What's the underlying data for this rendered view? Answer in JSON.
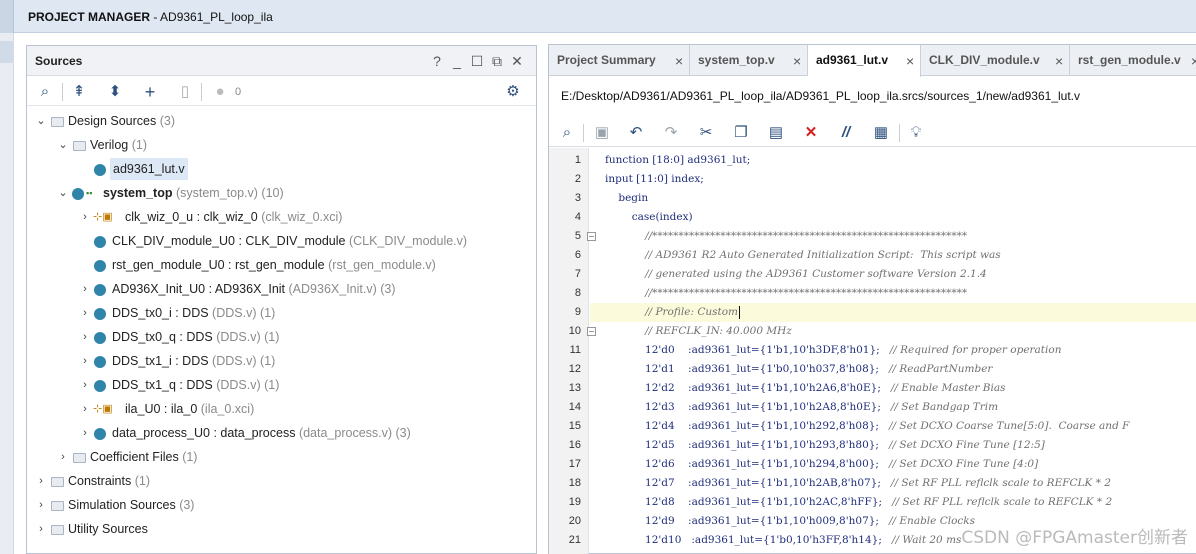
{
  "project_manager": {
    "label": "PROJECT MANAGER",
    "separator": " - ",
    "project": "AD9361_PL_loop_ila"
  },
  "sources": {
    "title": "Sources",
    "help": "?",
    "status_count": "0",
    "tree": [
      {
        "label": "Design Sources",
        "meta": "(3)"
      },
      {
        "label": "Verilog",
        "meta": "(1)"
      },
      {
        "label": "ad9361_lut.v",
        "meta": ""
      },
      {
        "label": "system_top",
        "meta": "(system_top.v) (10)"
      },
      {
        "label": "clk_wiz_0_u : clk_wiz_0",
        "meta": "(clk_wiz_0.xci)"
      },
      {
        "label": "CLK_DIV_module_U0 : CLK_DIV_module",
        "meta": "(CLK_DIV_module.v)"
      },
      {
        "label": "rst_gen_module_U0 : rst_gen_module",
        "meta": "(rst_gen_module.v)"
      },
      {
        "label": "AD936X_Init_U0 : AD936X_Init",
        "meta": "(AD936X_Init.v) (3)"
      },
      {
        "label": "DDS_tx0_i : DDS",
        "meta": "(DDS.v) (1)"
      },
      {
        "label": "DDS_tx0_q : DDS",
        "meta": "(DDS.v) (1)"
      },
      {
        "label": "DDS_tx1_i : DDS",
        "meta": "(DDS.v) (1)"
      },
      {
        "label": "DDS_tx1_q : DDS",
        "meta": "(DDS.v) (1)"
      },
      {
        "label": "ila_U0 : ila_0",
        "meta": "(ila_0.xci)"
      },
      {
        "label": "data_process_U0 : data_process",
        "meta": "(data_process.v) (3)"
      },
      {
        "label": "Coefficient Files",
        "meta": "(1)"
      },
      {
        "label": "Constraints",
        "meta": "(1)"
      },
      {
        "label": "Simulation Sources",
        "meta": "(3)"
      },
      {
        "label": "Utility Sources",
        "meta": ""
      }
    ]
  },
  "editor": {
    "tabs": [
      {
        "label": "Project Summary"
      },
      {
        "label": "system_top.v"
      },
      {
        "label": "ad9361_lut.v"
      },
      {
        "label": "CLK_DIV_module.v"
      },
      {
        "label": "rst_gen_module.v"
      }
    ],
    "path": "E:/Desktop/AD9361/AD9361_PL_loop_ila/AD9361_PL_loop_ila.srcs/sources_1/new/ad9361_lut.v",
    "lines": [
      {
        "n": "1",
        "code": "function [18:0] ad9361_lut;",
        "cmt": ""
      },
      {
        "n": "2",
        "code": "input [11:0] index;",
        "cmt": ""
      },
      {
        "n": "3",
        "code": "    begin",
        "cmt": ""
      },
      {
        "n": "4",
        "code": "        case(index)",
        "cmt": ""
      },
      {
        "n": "5",
        "code": "            ",
        "cmt": "//************************************************************"
      },
      {
        "n": "6",
        "code": "            ",
        "cmt": "// AD9361 R2 Auto Generated Initialization Script:  This script was"
      },
      {
        "n": "7",
        "code": "            ",
        "cmt": "// generated using the AD9361 Customer software Version 2.1.4"
      },
      {
        "n": "8",
        "code": "            ",
        "cmt": "//************************************************************"
      },
      {
        "n": "9",
        "code": "            ",
        "cmt": "// Profile: Custom"
      },
      {
        "n": "10",
        "code": "            ",
        "cmt": "// REFCLK_IN: 40.000 MHz"
      },
      {
        "n": "11",
        "code": "            12'd0    :ad9361_lut={1'b1,10'h3DF,8'h01};   ",
        "cmt": "// Required for proper operation"
      },
      {
        "n": "12",
        "code": "            12'd1    :ad9361_lut={1'b0,10'h037,8'h08};   ",
        "cmt": "// ReadPartNumber"
      },
      {
        "n": "13",
        "code": "            12'd2    :ad9361_lut={1'b1,10'h2A6,8'h0E};   ",
        "cmt": "// Enable Master Bias"
      },
      {
        "n": "14",
        "code": "            12'd3    :ad9361_lut={1'b1,10'h2A8,8'h0E};   ",
        "cmt": "// Set Bandgap Trim"
      },
      {
        "n": "15",
        "code": "            12'd4    :ad9361_lut={1'b1,10'h292,8'h08};   ",
        "cmt": "// Set DCXO Coarse Tune[5:0].  Coarse and F"
      },
      {
        "n": "16",
        "code": "            12'd5    :ad9361_lut={1'b1,10'h293,8'h80};   ",
        "cmt": "// Set DCXO Fine Tune [12:5]"
      },
      {
        "n": "17",
        "code": "            12'd6    :ad9361_lut={1'b1,10'h294,8'h00};   ",
        "cmt": "// Set DCXO Fine Tune [4:0]"
      },
      {
        "n": "18",
        "code": "            12'd7    :ad9361_lut={1'b1,10'h2AB,8'h07};   ",
        "cmt": "// Set RF PLL reflclk scale to REFCLK * 2"
      },
      {
        "n": "19",
        "code": "            12'd8    :ad9361_lut={1'b1,10'h2AC,8'hFF};   ",
        "cmt": "// Set RF PLL reflclk scale to REFCLK * 2"
      },
      {
        "n": "20",
        "code": "            12'd9    :ad9361_lut={1'b1,10'h009,8'h07};   ",
        "cmt": "// Enable Clocks"
      },
      {
        "n": "21",
        "code": "            12'd10   :ad9361_lut={1'b0,10'h3FF,8'h14};   ",
        "cmt": "// Wait 20 ms"
      }
    ]
  },
  "watermark": "CSDN @FPGAmaster创新者"
}
